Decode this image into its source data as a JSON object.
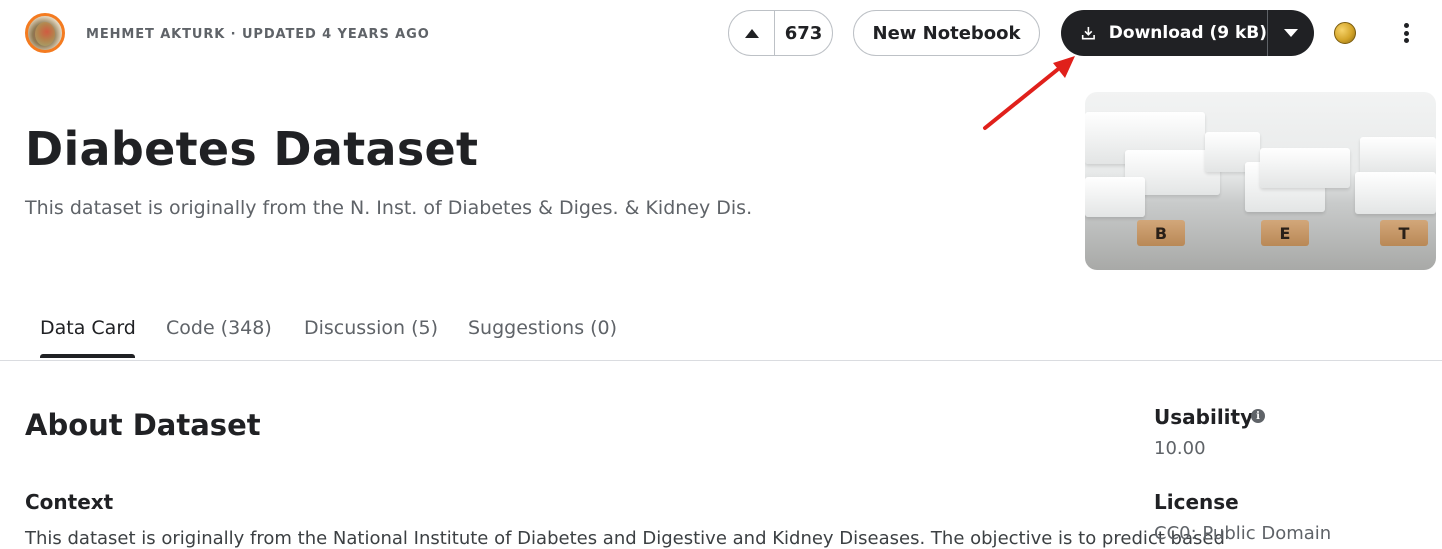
{
  "header": {
    "byline": "MEHMET AKTURK · UPDATED 4 YEARS AGO",
    "vote_count": "673",
    "new_notebook_label": "New Notebook",
    "download_label": "Download (9 kB)"
  },
  "dataset": {
    "title": "Diabetes Dataset",
    "subtitle": "This dataset is originally from the N. Inst. of Diabetes & Diges. & Kidney Dis.",
    "image_tiles": [
      "B",
      "E",
      "T"
    ]
  },
  "tabs": [
    {
      "label": "Data Card",
      "active": true
    },
    {
      "label": "Code (348)",
      "active": false
    },
    {
      "label": "Discussion (5)",
      "active": false
    },
    {
      "label": "Suggestions (0)",
      "active": false
    }
  ],
  "main": {
    "about_heading": "About Dataset",
    "context_heading": "Context",
    "context_text": "This dataset is originally from the National Institute of Diabetes and Digestive and Kidney Diseases. The objective is to predict based"
  },
  "sidebar": {
    "usability_heading": "Usability",
    "usability_value": "10.00",
    "license_heading": "License",
    "license_value": "CC0: Public Domain"
  },
  "colors": {
    "accent_dark": "#202124",
    "arrow_red": "#e0201b",
    "avatar_ring": "#f47b20"
  },
  "icons": {
    "upvote": "caret-up-icon",
    "download": "download-icon",
    "dropdown": "caret-down-icon",
    "medal": "medal-icon",
    "more": "more-vertical-icon",
    "info": "info-icon"
  }
}
